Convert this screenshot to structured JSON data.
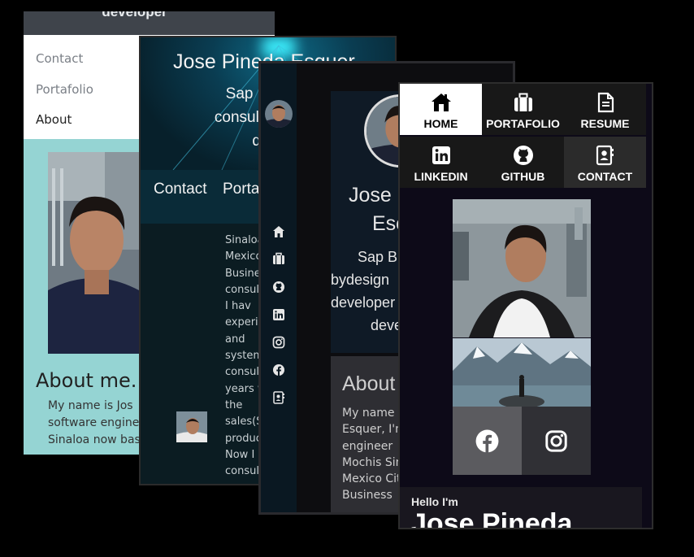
{
  "card1": {
    "topbar_text": "developer",
    "nav": [
      "Contact",
      "Portafolio",
      "About"
    ],
    "heading": "About me.",
    "paragraph": [
      "My name is Jos",
      "software engine",
      "Sinaloa now bas"
    ]
  },
  "card2": {
    "name": "Jose Pineda Esquer",
    "subtitle": [
      "Sap Busines",
      "consultant-deve",
      "deve"
    ],
    "nav": [
      "Contact",
      "Porta"
    ],
    "text_lines": [
      "Sinaloa",
      "Mexico",
      "Busines",
      "consult",
      "I hav",
      "experie",
      "and",
      "systems",
      "consult",
      "years w",
      "the",
      "sales(SI",
      "produc",
      "Now I",
      "consult"
    ]
  },
  "card3": {
    "name_line1": "Jose",
    "name_line2": "Esc",
    "subtitle": [
      "Sap B",
      "bydesign",
      "developer",
      "deve"
    ],
    "about_heading": "About",
    "about_lines": [
      "My name is",
      "Esquer, I'm",
      "engineer",
      "Mochis Sin",
      "Mexico Cit",
      "Business"
    ],
    "sidebar_icons": [
      "home-icon",
      "briefcase-icon",
      "github-icon",
      "linkedin-icon",
      "instagram-icon",
      "facebook-icon",
      "contact-card-icon"
    ]
  },
  "card4": {
    "nav": [
      {
        "label": "HOME",
        "icon": "home-icon",
        "active": true
      },
      {
        "label": "PORTAFOLIO",
        "icon": "briefcase-icon",
        "active": false
      },
      {
        "label": "RESUME",
        "icon": "document-icon",
        "active": false
      },
      {
        "label": "LINKEDIN",
        "icon": "linkedin-icon",
        "active": false
      },
      {
        "label": "GITHUB",
        "icon": "github-icon",
        "active": false
      },
      {
        "label": "CONTACT",
        "icon": "contact-card-icon",
        "active": false
      }
    ],
    "social": [
      "facebook-icon",
      "instagram-icon"
    ],
    "hello": "Hello I'm",
    "name": "Jose Pineda"
  }
}
